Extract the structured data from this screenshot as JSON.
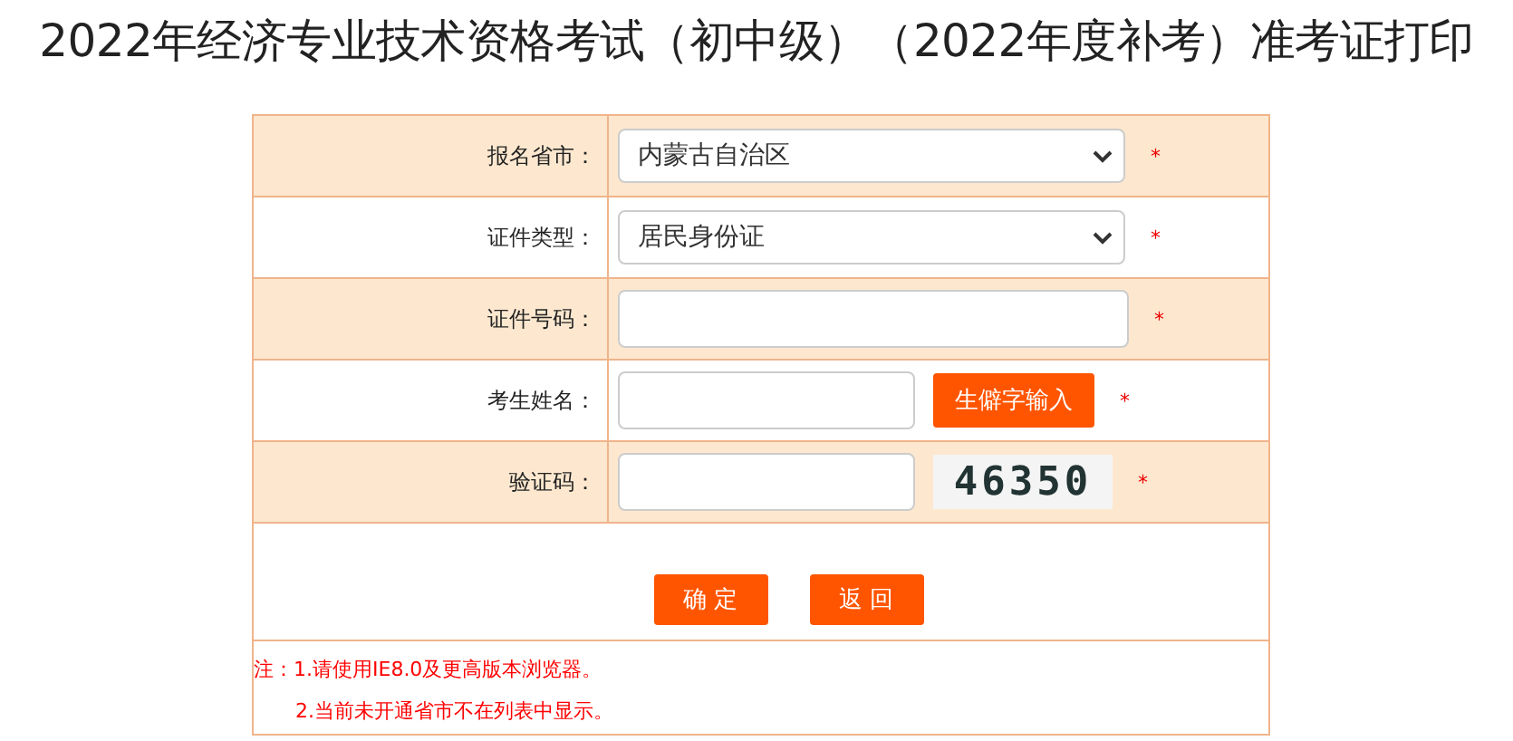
{
  "title": "2022年经济专业技术资格考试（初中级）（2022年度补考）准考证打印",
  "rows": [
    {
      "kind": "select",
      "label": "报名省市：",
      "value": "内蒙古自治区",
      "required": "*"
    },
    {
      "kind": "select",
      "label": "证件类型：",
      "value": "居民身份证",
      "required": "*"
    },
    {
      "kind": "input",
      "label": "证件号码：",
      "required": "*"
    },
    {
      "kind": "input_button",
      "label": "考生姓名：",
      "button": "生僻字输入",
      "required": "*"
    },
    {
      "kind": "captcha",
      "label": "验证码：",
      "captcha": "46350",
      "required": "*"
    }
  ],
  "buttons": [
    "确 定",
    "返 回"
  ],
  "notes": [
    "注：1.请使用IE8.0及更高版本浏览器。",
    "2.当前未开通省市不在列表中显示。"
  ]
}
